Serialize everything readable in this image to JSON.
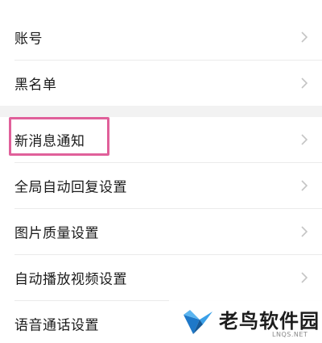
{
  "settings": {
    "items": [
      {
        "label": "账号",
        "icon": "chevron-right-icon"
      },
      {
        "label": "黑名单",
        "icon": "chevron-right-icon"
      },
      {
        "label": "新消息通知",
        "icon": "chevron-right-icon",
        "highlighted": true
      },
      {
        "label": "全局自动回复设置",
        "icon": "chevron-right-icon"
      },
      {
        "label": "图片质量设置",
        "icon": "chevron-right-icon"
      },
      {
        "label": "自动播放视频设置",
        "icon": "chevron-right-icon"
      },
      {
        "label": "语音通话设置",
        "icon": "chevron-right-icon"
      }
    ]
  },
  "highlight_color": "#e0609a",
  "watermark": {
    "text": "老鸟软件园",
    "sub": "LNQS.NET",
    "icon": "bird-logo-icon"
  }
}
